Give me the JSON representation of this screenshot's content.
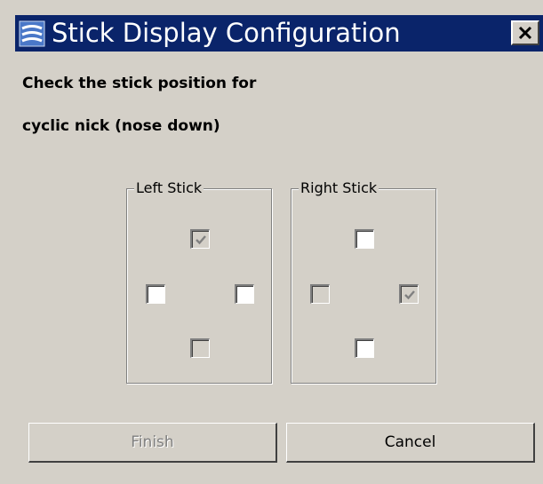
{
  "window": {
    "title": "Stick Display Configuration",
    "close_label": "✕"
  },
  "instructions": {
    "line1": "Check the stick position for",
    "line2": "cyclic nick (nose down)"
  },
  "left_stick": {
    "label": "Left Stick",
    "up": {
      "checked": true,
      "enabled": false
    },
    "left": {
      "checked": false,
      "enabled": true
    },
    "right": {
      "checked": false,
      "enabled": true
    },
    "down": {
      "checked": false,
      "enabled": false
    }
  },
  "right_stick": {
    "label": "Right Stick",
    "up": {
      "checked": false,
      "enabled": true
    },
    "left": {
      "checked": false,
      "enabled": false
    },
    "right": {
      "checked": true,
      "enabled": false
    },
    "down": {
      "checked": false,
      "enabled": true
    }
  },
  "buttons": {
    "finish": {
      "label": "Finish",
      "enabled": false
    },
    "cancel": {
      "label": "Cancel",
      "enabled": true
    }
  },
  "colors": {
    "titlebar": "#0a246a",
    "face": "#d4d0c8"
  }
}
